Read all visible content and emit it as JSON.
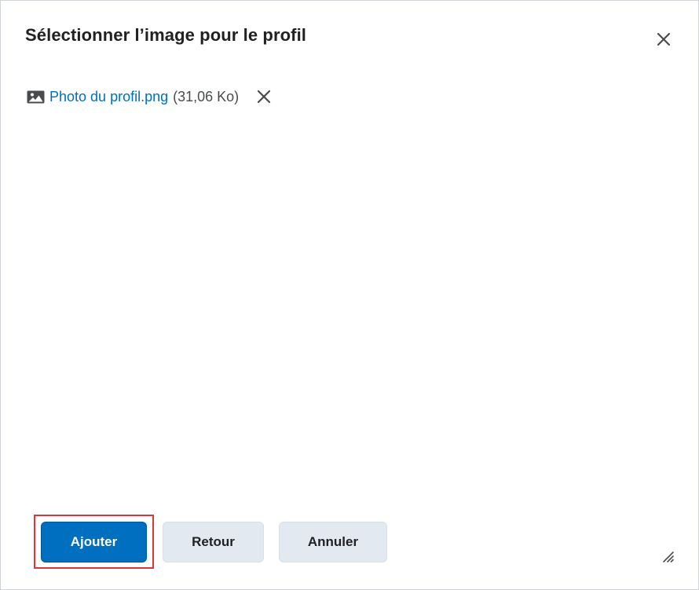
{
  "dialog": {
    "title": "Sélectionner l’image pour le profil",
    "close_icon": "close-icon"
  },
  "file": {
    "icon": "image-icon",
    "name": "Photo du profil.png",
    "size": "(31,06 Ko)",
    "remove_icon": "close-icon"
  },
  "footer": {
    "add_label": "Ajouter",
    "back_label": "Retour",
    "cancel_label": "Annuler"
  },
  "colors": {
    "primary": "#006fbf",
    "secondary_bg": "#e3e9f1",
    "highlight": "#d9363e",
    "link": "#006fbf"
  }
}
